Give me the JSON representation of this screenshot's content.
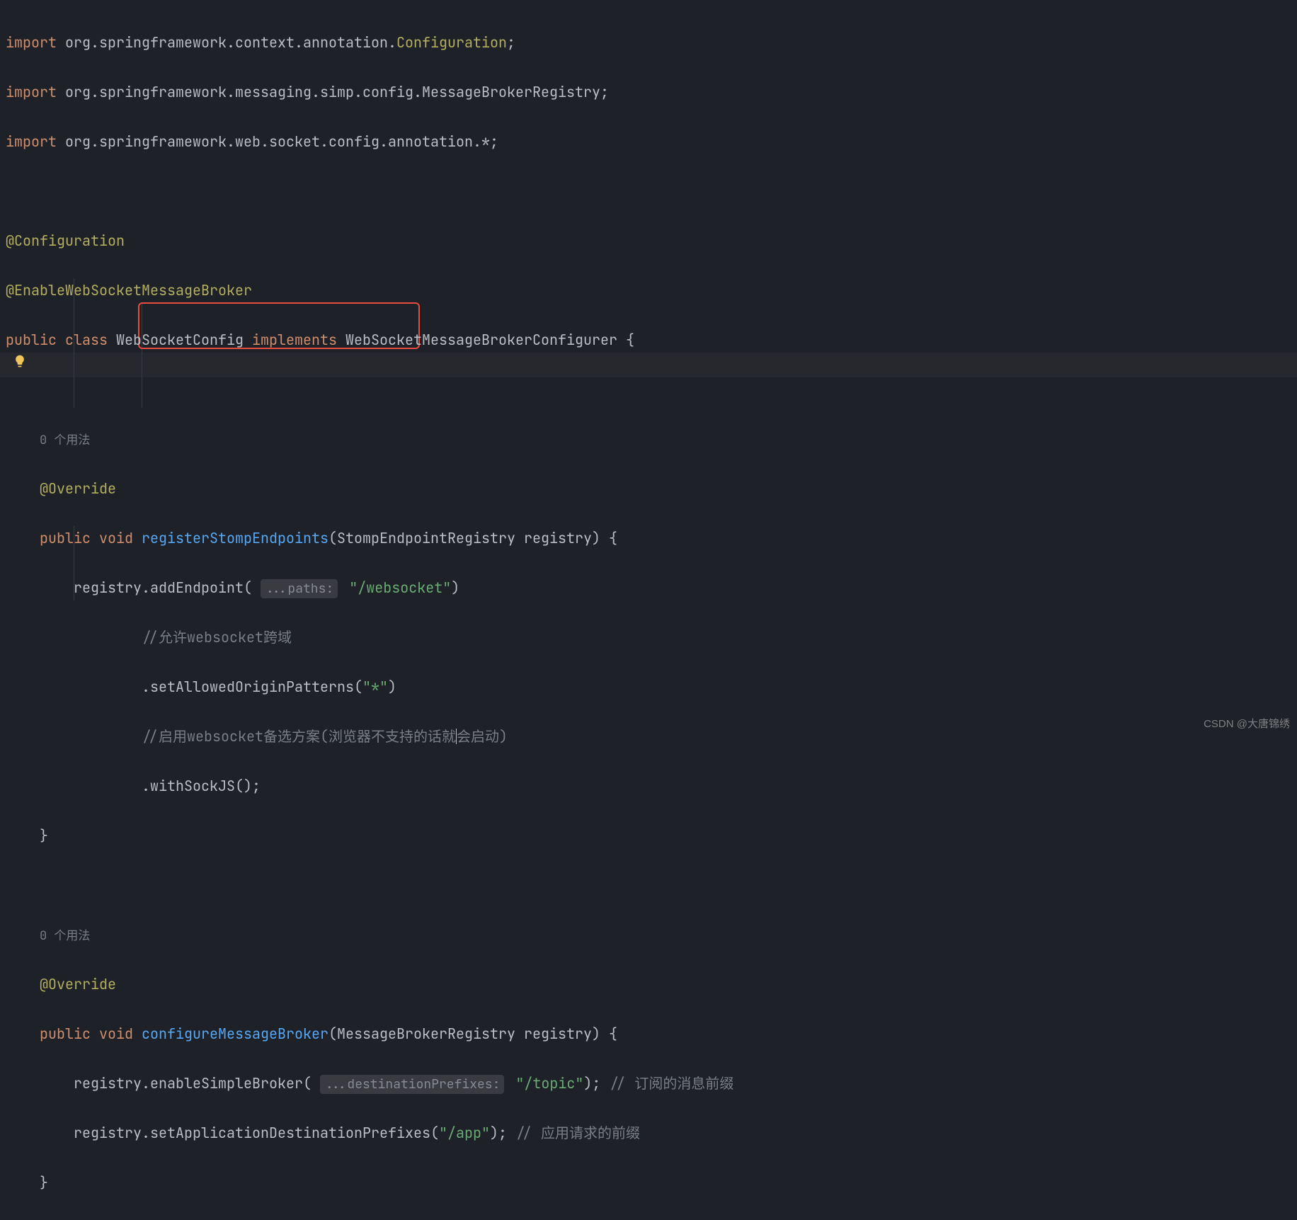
{
  "imports": [
    {
      "prefix": "org.springframework.context.annotation.",
      "suffix": "Configuration",
      "tail": ";"
    },
    {
      "prefix": "org.springframework.messaging.simp.config.MessageBrokerRegistry;"
    },
    {
      "prefix": "org.springframework.web.socket.config.annotation.*;"
    }
  ],
  "annotations": {
    "config": "@Configuration",
    "enable": "@EnableWebSocketMessageBroker",
    "override": "@Override"
  },
  "class_decl": {
    "public": "public",
    "class": "class",
    "name": "WebSocketConfig",
    "implements": "implements",
    "iface": "WebSocketMessageBrokerConfigurer",
    "brace": " {"
  },
  "usage_hint": "0 个用法",
  "method1": {
    "public": "public",
    "void": "void",
    "name": "registerStompEndpoints",
    "params": "(StompEndpointRegistry registry) {",
    "line1_pre": "registry.addEndpoint( ",
    "line1_hint": "...paths:",
    "line1_str": "\"/websocket\"",
    "line1_post": ")",
    "comment1": "//允许websocket跨域",
    "line2": ".setAllowedOriginPatterns(",
    "line2_str": "\"*\"",
    "line2_post": ")",
    "comment2_a": "//启用websocket备选方案(浏览器不支持的话就",
    "comment2_b": "会启动)",
    "line3": ".withSockJS();",
    "close": "}"
  },
  "method2": {
    "public": "public",
    "void": "void",
    "name": "configureMessageBroker",
    "params": "(MessageBrokerRegistry registry) {",
    "line1_pre": "registry.enableSimpleBroker( ",
    "line1_hint": "...destinationPrefixes:",
    "line1_str": "\"/topic\"",
    "line1_post": "); ",
    "line1_comment": "// 订阅的消息前缀",
    "line2_pre": "registry.setApplicationDestinationPrefixes(",
    "line2_str": "\"/app\"",
    "line2_post": "); ",
    "line2_comment": "// 应用请求的前缀",
    "close": "}"
  },
  "kw": {
    "import": "import"
  },
  "watermark": "CSDN @大唐锦绣"
}
